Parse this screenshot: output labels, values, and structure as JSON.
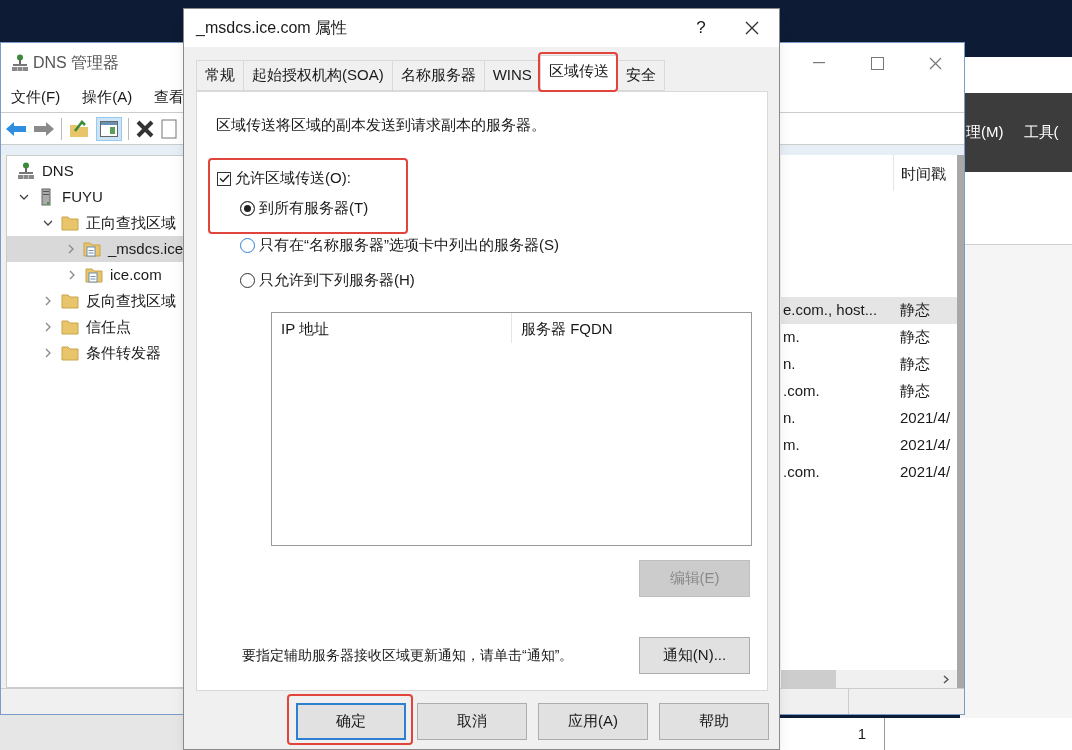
{
  "background_window": {
    "menu": [
      "理(M)",
      "工具("
    ],
    "status_cell": "1"
  },
  "dns_manager": {
    "title": "DNS 管理器",
    "menu": [
      "文件(F)",
      "操作(A)",
      "查看"
    ],
    "tree": [
      {
        "label": "DNS",
        "kind": "dns",
        "selected": false,
        "children": [
          {
            "label": "FUYU",
            "kind": "server",
            "expanded": true,
            "selected": false,
            "children": [
              {
                "label": "正向查找区域",
                "kind": "folder",
                "expanded": true,
                "selected": false,
                "children": [
                  {
                    "label": "_msdcs.ice",
                    "kind": "zone",
                    "expanded": false,
                    "selected": true
                  },
                  {
                    "label": "ice.com",
                    "kind": "zone",
                    "expanded": false,
                    "selected": false
                  }
                ]
              },
              {
                "label": "反向查找区域",
                "kind": "folder",
                "expanded": false,
                "selected": false
              },
              {
                "label": "信任点",
                "kind": "folder",
                "expanded": false,
                "selected": false
              },
              {
                "label": "条件转发器",
                "kind": "folder",
                "expanded": false,
                "selected": false
              }
            ]
          }
        ]
      }
    ],
    "list": {
      "columns": [
        "时间戳"
      ],
      "rows": [
        {
          "column_1": "e.com., host...",
          "timestamp": "静态",
          "selected": true
        },
        {
          "column_1": "m.",
          "timestamp": "静态",
          "selected": false
        },
        {
          "column_1": "n.",
          "timestamp": "静态",
          "selected": false
        },
        {
          "column_1": ".com.",
          "timestamp": "静态",
          "selected": false
        },
        {
          "column_1": "n.",
          "timestamp": "2021/4/",
          "selected": false
        },
        {
          "column_1": "m.",
          "timestamp": "2021/4/",
          "selected": false
        },
        {
          "column_1": ".com.",
          "timestamp": "2021/4/",
          "selected": false
        }
      ]
    }
  },
  "dialog": {
    "title": "_msdcs.ice.com 属性",
    "help": "?",
    "tabs": [
      {
        "label": "常规",
        "selected": false,
        "highlighted": false
      },
      {
        "label": "起始授权机构(SOA)",
        "selected": false,
        "highlighted": false
      },
      {
        "label": "名称服务器",
        "selected": false,
        "highlighted": false
      },
      {
        "label": "WINS",
        "selected": false,
        "highlighted": false
      },
      {
        "label": "区域传送",
        "selected": true,
        "highlighted": true
      },
      {
        "label": "安全",
        "selected": false,
        "highlighted": false
      }
    ],
    "description": "区域传送将区域的副本发送到请求副本的服务器。",
    "allow_transfer": {
      "label": "允许区域传送(O):",
      "checked": true
    },
    "options": [
      {
        "label": "到所有服务器(T)",
        "selected": true
      },
      {
        "label": "只有在“名称服务器”选项卡中列出的服务器(S)",
        "selected": false
      },
      {
        "label": "只允许到下列服务器(H)",
        "selected": false
      }
    ],
    "options_highlighted": true,
    "servers_table": {
      "columns": [
        "IP 地址",
        "服务器 FQDN"
      ]
    },
    "edit_button": {
      "label": "编辑(E)",
      "disabled": true
    },
    "notify_text": "要指定辅助服务器接收区域更新通知，请单击“通知”。",
    "notify_button": "通知(N)...",
    "buttons": [
      {
        "label": "确定",
        "default": true,
        "highlighted": true
      },
      {
        "label": "取消",
        "default": false,
        "highlighted": false
      },
      {
        "label": "应用(A)",
        "default": false,
        "highlighted": false
      },
      {
        "label": "帮助",
        "default": false,
        "highlighted": false
      }
    ]
  }
}
